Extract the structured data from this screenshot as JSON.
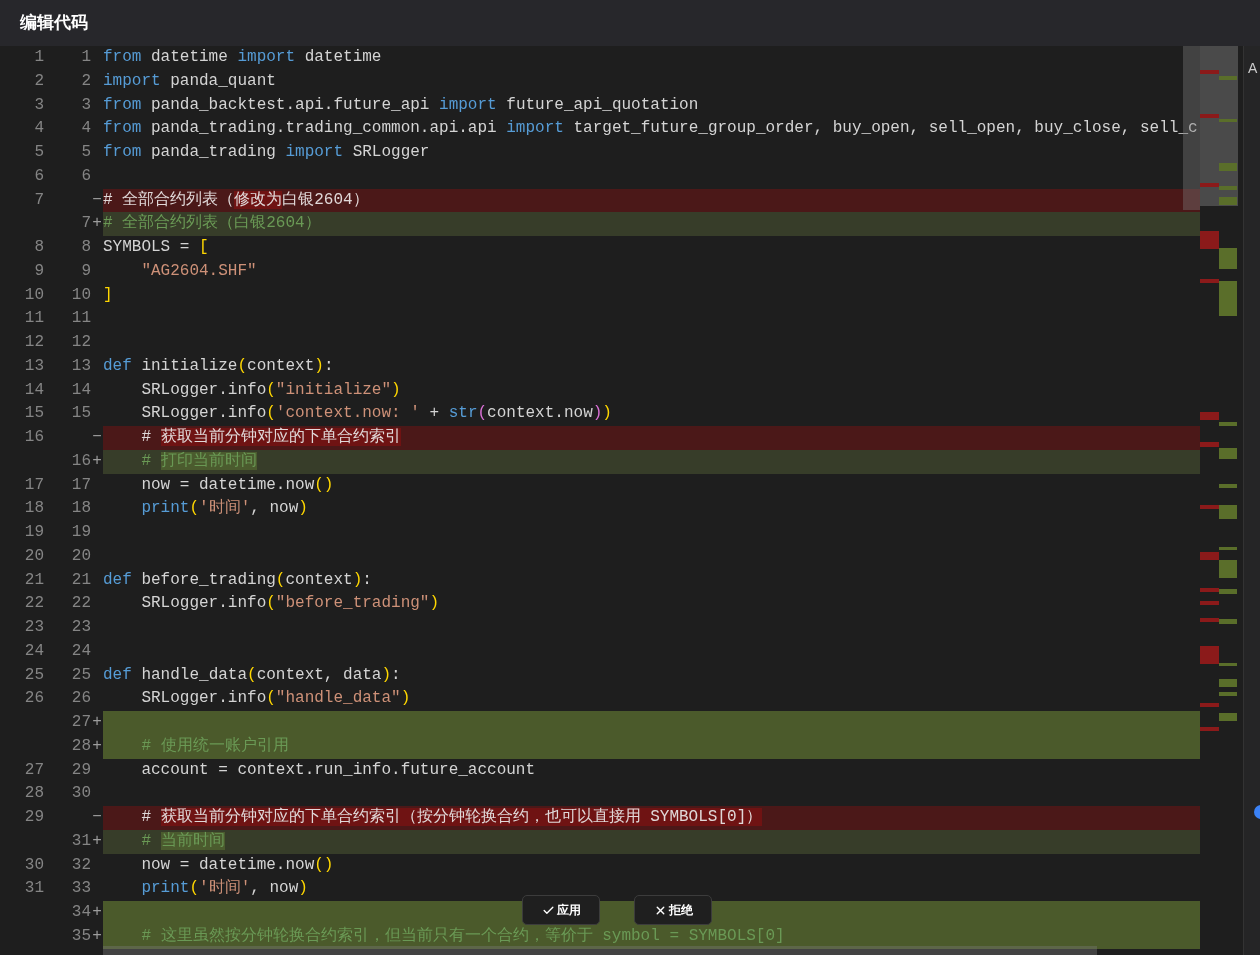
{
  "title": "编辑代码",
  "lines": [
    {
      "kind": "context",
      "old": "1",
      "new": "1",
      "tokens": [
        {
          "text": "from",
          "kind": "keyword"
        },
        {
          "text": " datetime ",
          "kind": "plain"
        },
        {
          "text": "import",
          "kind": "keyword"
        },
        {
          "text": " datetime",
          "kind": "plain"
        }
      ]
    },
    {
      "kind": "context",
      "old": "2",
      "new": "2",
      "tokens": [
        {
          "text": "import",
          "kind": "keyword"
        },
        {
          "text": " panda_quant",
          "kind": "plain"
        }
      ]
    },
    {
      "kind": "context",
      "old": "3",
      "new": "3",
      "tokens": [
        {
          "text": "from",
          "kind": "keyword"
        },
        {
          "text": " panda_backtest.api.future_api ",
          "kind": "plain"
        },
        {
          "text": "import",
          "kind": "keyword"
        },
        {
          "text": " future_api_quotation",
          "kind": "plain"
        }
      ]
    },
    {
      "kind": "context",
      "old": "4",
      "new": "4",
      "tokens": [
        {
          "text": "from",
          "kind": "keyword"
        },
        {
          "text": " panda_trading.trading_common.api.api ",
          "kind": "plain"
        },
        {
          "text": "import",
          "kind": "keyword"
        },
        {
          "text": " target_future_group_order, buy_open, sell_open, buy_close, sell_c",
          "kind": "plain"
        }
      ]
    },
    {
      "kind": "context",
      "old": "5",
      "new": "5",
      "tokens": [
        {
          "text": "from",
          "kind": "keyword"
        },
        {
          "text": " panda_trading ",
          "kind": "plain"
        },
        {
          "text": "import",
          "kind": "keyword"
        },
        {
          "text": " SRLogger",
          "kind": "plain"
        }
      ]
    },
    {
      "kind": "context",
      "old": "6",
      "new": "6"
    },
    {
      "kind": "removed",
      "old": "7",
      "marker": "−",
      "tokens": [
        {
          "text": "# 全部合约列表（",
          "kind": "comment",
          "changed": false
        },
        {
          "text": "修改为",
          "kind": "comment",
          "changed": true
        },
        {
          "text": "白银2604）",
          "kind": "comment",
          "changed": false
        }
      ]
    },
    {
      "kind": "added",
      "new": "7",
      "marker": "+",
      "tokens": [
        {
          "text": "# 全部合约列表（白银2604）",
          "kind": "comment",
          "changed": false
        }
      ]
    },
    {
      "kind": "context",
      "old": "8",
      "new": "8",
      "tokens": [
        {
          "text": "SYMBOLS = ",
          "kind": "plain"
        },
        {
          "text": "[",
          "kind": "bracket"
        }
      ]
    },
    {
      "kind": "context",
      "old": "9",
      "new": "9",
      "tokens": [
        {
          "text": "    \"AG2604.SHF\"",
          "kind": "string"
        }
      ]
    },
    {
      "kind": "context",
      "old": "10",
      "new": "10",
      "tokens": [
        {
          "text": "]",
          "kind": "bracket"
        }
      ]
    },
    {
      "kind": "context",
      "old": "11",
      "new": "11"
    },
    {
      "kind": "context",
      "old": "12",
      "new": "12"
    },
    {
      "kind": "context",
      "old": "13",
      "new": "13",
      "tokens": [
        {
          "text": "def",
          "kind": "keyword"
        },
        {
          "text": " initialize",
          "kind": "plain"
        },
        {
          "text": "(",
          "kind": "bracket"
        },
        {
          "text": "context",
          "kind": "plain"
        },
        {
          "text": ")",
          "kind": "bracket"
        },
        {
          "text": ":",
          "kind": "plain"
        }
      ]
    },
    {
      "kind": "context",
      "old": "14",
      "new": "14",
      "tokens": [
        {
          "text": "    SRLogger.info",
          "kind": "plain"
        },
        {
          "text": "(",
          "kind": "bracket"
        },
        {
          "text": "\"initialize\"",
          "kind": "string"
        },
        {
          "text": ")",
          "kind": "bracket"
        }
      ]
    },
    {
      "kind": "context",
      "old": "15",
      "new": "15",
      "tokens": [
        {
          "text": "    SRLogger.info",
          "kind": "plain"
        },
        {
          "text": "(",
          "kind": "bracket"
        },
        {
          "text": "'context.now: '",
          "kind": "string"
        },
        {
          "text": " + ",
          "kind": "plain"
        },
        {
          "text": "str",
          "kind": "keyword"
        },
        {
          "text": "(",
          "kind": "bracket2"
        },
        {
          "text": "context.now",
          "kind": "plain"
        },
        {
          "text": ")",
          "kind": "bracket2"
        },
        {
          "text": ")",
          "kind": "bracket"
        }
      ]
    },
    {
      "kind": "removed",
      "old": "16",
      "marker": "−",
      "tokens": [
        {
          "text": "    # ",
          "kind": "comment",
          "changed": false
        },
        {
          "text": "获取当前分钟对应的下单合约索引",
          "kind": "comment",
          "changed": true
        }
      ]
    },
    {
      "kind": "added",
      "new": "16",
      "marker": "+",
      "tokens": [
        {
          "text": "    # ",
          "kind": "comment",
          "changed": false
        },
        {
          "text": "打印当前时间",
          "kind": "comment",
          "changed": true
        }
      ]
    },
    {
      "kind": "context",
      "old": "17",
      "new": "17",
      "tokens": [
        {
          "text": "    now = datetime.now",
          "kind": "plain"
        },
        {
          "text": "()",
          "kind": "bracket"
        }
      ]
    },
    {
      "kind": "context",
      "old": "18",
      "new": "18",
      "tokens": [
        {
          "text": "    print",
          "kind": "keyword"
        },
        {
          "text": "(",
          "kind": "bracket"
        },
        {
          "text": "'时间'",
          "kind": "string"
        },
        {
          "text": ", now",
          "kind": "plain"
        },
        {
          "text": ")",
          "kind": "bracket"
        }
      ]
    },
    {
      "kind": "context",
      "old": "19",
      "new": "19"
    },
    {
      "kind": "context",
      "old": "20",
      "new": "20"
    },
    {
      "kind": "context",
      "old": "21",
      "new": "21",
      "tokens": [
        {
          "text": "def",
          "kind": "keyword"
        },
        {
          "text": " before_trading",
          "kind": "plain"
        },
        {
          "text": "(",
          "kind": "bracket"
        },
        {
          "text": "context",
          "kind": "plain"
        },
        {
          "text": ")",
          "kind": "bracket"
        },
        {
          "text": ":",
          "kind": "plain"
        }
      ]
    },
    {
      "kind": "context",
      "old": "22",
      "new": "22",
      "tokens": [
        {
          "text": "    SRLogger.info",
          "kind": "plain"
        },
        {
          "text": "(",
          "kind": "bracket"
        },
        {
          "text": "\"before_trading\"",
          "kind": "string"
        },
        {
          "text": ")",
          "kind": "bracket"
        }
      ]
    },
    {
      "kind": "context",
      "old": "23",
      "new": "23"
    },
    {
      "kind": "context",
      "old": "24",
      "new": "24"
    },
    {
      "kind": "context",
      "old": "25",
      "new": "25",
      "tokens": [
        {
          "text": "def",
          "kind": "keyword"
        },
        {
          "text": " handle_data",
          "kind": "plain"
        },
        {
          "text": "(",
          "kind": "bracket"
        },
        {
          "text": "context, data",
          "kind": "plain"
        },
        {
          "text": ")",
          "kind": "bracket"
        },
        {
          "text": ":",
          "kind": "plain"
        }
      ]
    },
    {
      "kind": "context",
      "old": "26",
      "new": "26",
      "tokens": [
        {
          "text": "    SRLogger.info",
          "kind": "plain"
        },
        {
          "text": "(",
          "kind": "bracket"
        },
        {
          "text": "\"handle_data\"",
          "kind": "string"
        },
        {
          "text": ")",
          "kind": "bracket"
        }
      ]
    },
    {
      "kind": "inserted",
      "new": "27",
      "marker": "+"
    },
    {
      "kind": "inserted",
      "new": "28",
      "marker": "+",
      "tokens": [
        {
          "text": "    # 使用统一账户引用",
          "kind": "comment"
        }
      ]
    },
    {
      "kind": "context",
      "old": "27",
      "new": "29",
      "tokens": [
        {
          "text": "    account = context.run_info.future_account",
          "kind": "plain"
        }
      ]
    },
    {
      "kind": "context",
      "old": "28",
      "new": "30"
    },
    {
      "kind": "removed",
      "old": "29",
      "marker": "−",
      "tokens": [
        {
          "text": "    # ",
          "kind": "comment",
          "changed": false
        },
        {
          "text": "获取当前分钟对应的下单合约索引（按分钟轮换合约，也可以直接用 SYMBOLS[0]）",
          "kind": "comment",
          "changed": true
        }
      ]
    },
    {
      "kind": "added",
      "new": "31",
      "marker": "+",
      "tokens": [
        {
          "text": "    # ",
          "kind": "comment",
          "changed": false
        },
        {
          "text": "当前时间",
          "kind": "comment",
          "changed": true
        }
      ]
    },
    {
      "kind": "context",
      "old": "30",
      "new": "32",
      "tokens": [
        {
          "text": "    now = datetime.now",
          "kind": "plain"
        },
        {
          "text": "()",
          "kind": "bracket"
        }
      ]
    },
    {
      "kind": "context",
      "old": "31",
      "new": "33",
      "tokens": [
        {
          "text": "    print",
          "kind": "keyword"
        },
        {
          "text": "(",
          "kind": "bracket"
        },
        {
          "text": "'时间'",
          "kind": "string"
        },
        {
          "text": ", now",
          "kind": "plain"
        },
        {
          "text": ")",
          "kind": "bracket"
        }
      ]
    },
    {
      "kind": "inserted",
      "new": "34",
      "marker": "+"
    },
    {
      "kind": "inserted",
      "new": "35",
      "marker": "+",
      "tokens": [
        {
          "text": "    # 这里虽然按分钟轮换合约索引，但当前只有一个合约，等价于 symbol = SYMBOLS[0]",
          "kind": "comment"
        }
      ]
    }
  ],
  "actions": [
    {
      "kind": "apply",
      "label": "应用"
    },
    {
      "kind": "reject",
      "label": "拒绝"
    }
  ],
  "side_panel": {
    "label": "A"
  }
}
